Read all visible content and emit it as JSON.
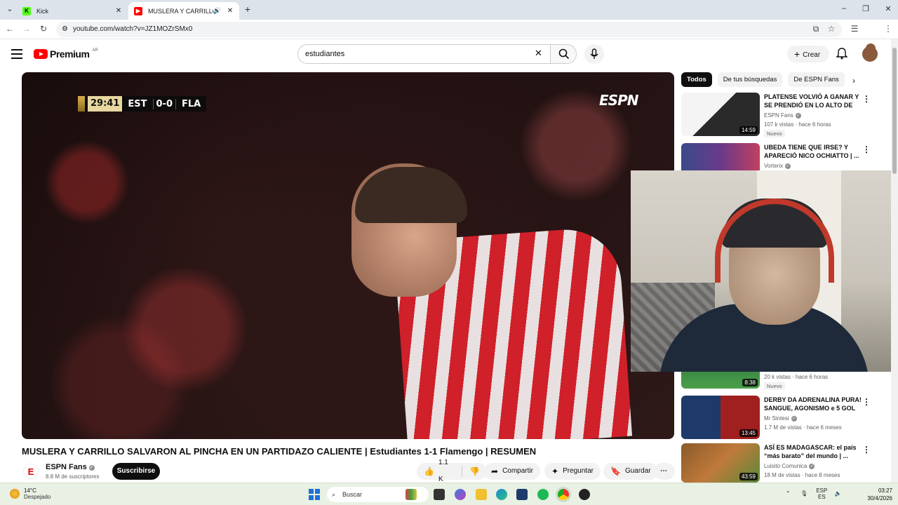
{
  "browser": {
    "tabs": [
      {
        "title": "Kick",
        "favicon": "kick-favicon",
        "active": false
      },
      {
        "title": "MUSLERA Y CARRILLO SALV",
        "favicon": "youtube-favicon",
        "active": true
      }
    ],
    "url": "youtube.com/watch?v=JZ1MOZrSMx0"
  },
  "youtube": {
    "logo_text": "Premium",
    "country": "AR",
    "search_value": "estudiantes",
    "create_label": "Crear"
  },
  "player": {
    "clock": "29:41",
    "home_team": "EST",
    "score": "0-0",
    "away_team": "FLA",
    "broadcaster": "ESPN"
  },
  "video": {
    "title": "MUSLERA Y CARRILLO SALVARON AL PINCHA EN UN PARTIDAZO CALIENTE | Estudiantes 1-1 Flamengo | RESUMEN",
    "channel": "ESPN Fans",
    "subscribers": "8.8 M de suscriptores",
    "subscribe_label": "Suscribirse",
    "likes": "1.1 K",
    "share_label": "Compartir",
    "ask_label": "Preguntar",
    "save_label": "Guardar"
  },
  "sidebar": {
    "chips": [
      "Todos",
      "De tus búsquedas",
      "De ESPN Fans"
    ],
    "recommendations": [
      {
        "title": "PLATENSE VOLVIÓ A GANAR Y SE PRENDIÓ EN LO ALTO DE S...",
        "channel": "ESPN Fans",
        "views": "107 k vistas",
        "age": "hace 6 horas",
        "badge": "Nuevo",
        "duration": "14:59",
        "thumb_color": "#7a1f24"
      },
      {
        "title": "UBEDA TIENE QUE IRSE? Y APARECIÓ NICO OCHIATTO | ...",
        "channel": "Vorterix",
        "views": "",
        "age": "",
        "badge": "",
        "duration": "",
        "thumb_color": "#3a4a8a"
      },
      {
        "title": "",
        "channel": "",
        "views": "20 k vistas",
        "age": "hace 6 horas",
        "badge": "Nuevo",
        "duration": "8:38",
        "thumb_color": "#2a6a3a"
      },
      {
        "title": "DERBY DA ADRENALINA PURA! SANGUE, AGONISMO e 5 GOL ...",
        "channel": "Mr Sintesi",
        "views": "1.7 M de vistas",
        "age": "hace 6 meses",
        "badge": "",
        "duration": "13:45",
        "thumb_color": "#1d3a6a"
      },
      {
        "title": "ASÍ ES MADAGASCAR: el país “más barato” del mundo | ...",
        "channel": "Luisito Comunica",
        "views": "18 M de vistas",
        "age": "hace 8 meses",
        "badge": "",
        "duration": "43:59",
        "thumb_color": "#8a5a2a"
      }
    ]
  },
  "taskbar": {
    "temperature": "14°C",
    "weather": "Despejado",
    "search_placeholder": "Buscar",
    "lang_top": "ESP",
    "lang_bottom": "ES",
    "time": "03:27",
    "date": "30/4/2026"
  }
}
